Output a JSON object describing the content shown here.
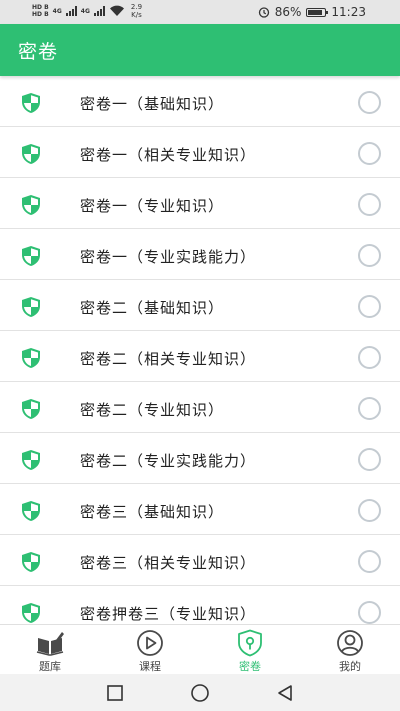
{
  "status_bar": {
    "sim1": "HD B",
    "sim2": "HD B",
    "net1": "4G",
    "net2": "4G",
    "speed_value": "2.9",
    "speed_unit": "K/s",
    "battery": "86%",
    "battery_level": 0.86,
    "time": "11:23"
  },
  "app_bar": {
    "title": "密卷"
  },
  "list": {
    "items": [
      {
        "label": "密卷一（基础知识）",
        "icon": "shield-icon",
        "selected": false
      },
      {
        "label": "密卷一（相关专业知识）",
        "icon": "shield-icon",
        "selected": false
      },
      {
        "label": "密卷一（专业知识）",
        "icon": "shield-icon",
        "selected": false
      },
      {
        "label": "密卷一（专业实践能力）",
        "icon": "shield-icon",
        "selected": false
      },
      {
        "label": "密卷二（基础知识）",
        "icon": "shield-icon",
        "selected": false
      },
      {
        "label": "密卷二（相关专业知识）",
        "icon": "shield-icon",
        "selected": false
      },
      {
        "label": "密卷二（专业知识）",
        "icon": "shield-icon",
        "selected": false
      },
      {
        "label": "密卷二（专业实践能力）",
        "icon": "shield-icon",
        "selected": false
      },
      {
        "label": "密卷三（基础知识）",
        "icon": "shield-icon",
        "selected": false
      },
      {
        "label": "密卷三（相关专业知识）",
        "icon": "shield-icon",
        "selected": false
      },
      {
        "label": "密卷押卷三（专业知识）",
        "icon": "shield-icon",
        "selected": false
      }
    ]
  },
  "tab_bar": {
    "tabs": [
      {
        "label": "题库",
        "icon": "book-icon",
        "active": false
      },
      {
        "label": "课程",
        "icon": "play-icon",
        "active": false
      },
      {
        "label": "密卷",
        "icon": "lock-shield-icon",
        "active": true
      },
      {
        "label": "我的",
        "icon": "user-icon",
        "active": false
      }
    ]
  },
  "nav_bar": {
    "buttons": [
      "recent-apps-icon",
      "home-icon",
      "back-icon"
    ]
  },
  "colors": {
    "accent": "#2ebf73",
    "radio_border": "#c4cbd1",
    "divider": "#e2e2e2"
  }
}
